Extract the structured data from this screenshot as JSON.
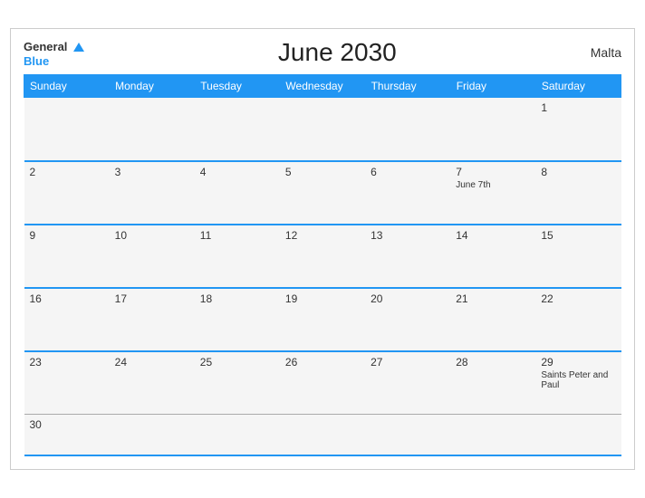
{
  "header": {
    "logo_general": "General",
    "logo_blue": "Blue",
    "title": "June 2030",
    "country": "Malta"
  },
  "weekdays": [
    "Sunday",
    "Monday",
    "Tuesday",
    "Wednesday",
    "Thursday",
    "Friday",
    "Saturday"
  ],
  "weeks": [
    [
      {
        "day": "",
        "event": ""
      },
      {
        "day": "",
        "event": ""
      },
      {
        "day": "",
        "event": ""
      },
      {
        "day": "",
        "event": ""
      },
      {
        "day": "",
        "event": ""
      },
      {
        "day": "",
        "event": ""
      },
      {
        "day": "1",
        "event": ""
      }
    ],
    [
      {
        "day": "2",
        "event": ""
      },
      {
        "day": "3",
        "event": ""
      },
      {
        "day": "4",
        "event": ""
      },
      {
        "day": "5",
        "event": ""
      },
      {
        "day": "6",
        "event": ""
      },
      {
        "day": "7",
        "event": "June 7th"
      },
      {
        "day": "8",
        "event": ""
      }
    ],
    [
      {
        "day": "9",
        "event": ""
      },
      {
        "day": "10",
        "event": ""
      },
      {
        "day": "11",
        "event": ""
      },
      {
        "day": "12",
        "event": ""
      },
      {
        "day": "13",
        "event": ""
      },
      {
        "day": "14",
        "event": ""
      },
      {
        "day": "15",
        "event": ""
      }
    ],
    [
      {
        "day": "16",
        "event": ""
      },
      {
        "day": "17",
        "event": ""
      },
      {
        "day": "18",
        "event": ""
      },
      {
        "day": "19",
        "event": ""
      },
      {
        "day": "20",
        "event": ""
      },
      {
        "day": "21",
        "event": ""
      },
      {
        "day": "22",
        "event": ""
      }
    ],
    [
      {
        "day": "23",
        "event": ""
      },
      {
        "day": "24",
        "event": ""
      },
      {
        "day": "25",
        "event": ""
      },
      {
        "day": "26",
        "event": ""
      },
      {
        "day": "27",
        "event": ""
      },
      {
        "day": "28",
        "event": ""
      },
      {
        "day": "29",
        "event": "Saints Peter and Paul"
      }
    ],
    [
      {
        "day": "30",
        "event": ""
      },
      {
        "day": "",
        "event": ""
      },
      {
        "day": "",
        "event": ""
      },
      {
        "day": "",
        "event": ""
      },
      {
        "day": "",
        "event": ""
      },
      {
        "day": "",
        "event": ""
      },
      {
        "day": "",
        "event": ""
      }
    ]
  ]
}
